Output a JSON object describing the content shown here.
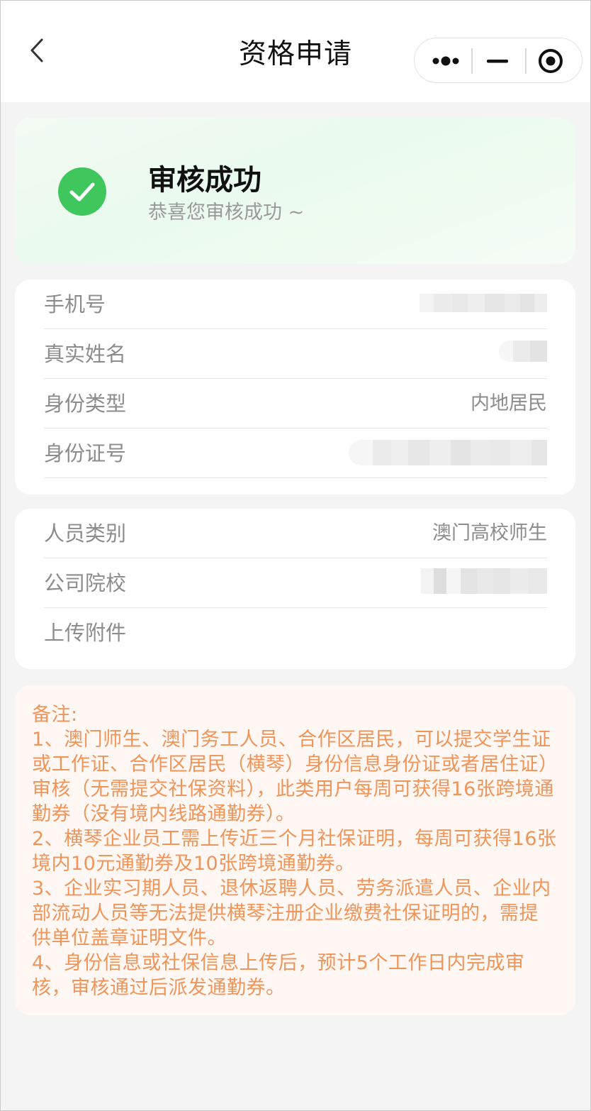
{
  "header": {
    "title": "资格申请",
    "back_icon": "chevron-left-icon",
    "capsule": {
      "more_icon": "more-dots-icon",
      "minimize_icon": "minimize-icon",
      "close_icon": "target-close-icon"
    }
  },
  "status": {
    "icon": "check-circle-icon",
    "title": "审核成功",
    "subtitle": "恭喜您审核成功 ~",
    "color": "#3fc75d"
  },
  "personal_info": {
    "rows": [
      {
        "label": "手机号",
        "value": ""
      },
      {
        "label": "真实姓名",
        "value": ""
      },
      {
        "label": "身份类型",
        "value": "内地居民"
      },
      {
        "label": "身份证号",
        "value": ""
      }
    ]
  },
  "identity_info": {
    "rows": [
      {
        "label": "人员类别",
        "value": "澳门高校师生"
      },
      {
        "label": "公司院校",
        "value": ""
      },
      {
        "label": "上传附件",
        "value": ""
      }
    ]
  },
  "notes": {
    "title": "备注:",
    "color": "#f0955a",
    "items": [
      "1、澳门师生、澳门务工人员、合作区居民，可以提交学生证或工作证、合作区居民（横琴）身份信息身份证或者居住证）审核（无需提交社保资料），此类用户每周可获得16张跨境通勤券（没有境内线路通勤券）。",
      "2、横琴企业员工需上传近三个月社保证明，每周可获得16张境内10元通勤券及10张跨境通勤券。",
      "3、企业实习期人员、退休返聘人员、劳务派遣人员、企业内部流动人员等无法提供横琴注册企业缴费社保证明的，需提供单位盖章证明文件。",
      "4、身份信息或社保信息上传后，预计5个工作日内完成审核，审核通过后派发通勤券。"
    ]
  }
}
